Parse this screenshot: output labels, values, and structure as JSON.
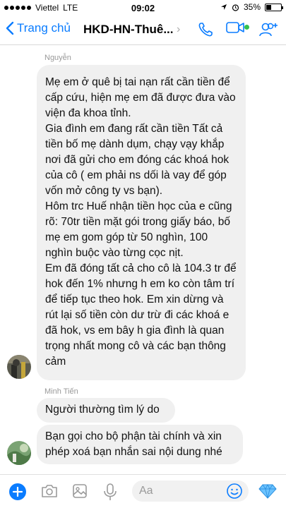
{
  "status_bar": {
    "carrier": "Viettel",
    "network": "LTE",
    "time": "09:02",
    "battery": "35%",
    "battery_level": 0.35
  },
  "nav": {
    "back_label": "Trang chủ",
    "title": "HKD-HN-Thuê...",
    "chevron": "›",
    "icons": [
      "phone-icon",
      "video-icon",
      "add-people-icon"
    ],
    "accent": "#0a7cff"
  },
  "messages": [
    {
      "sender": "Nguyễn",
      "paragraphs": [
        "Mẹ em ở quê bị tai nạn rất cần tiền để cấp cứu,  hiện mẹ em đã được đưa vào viện đa khoa tỉnh.",
        "Gia đình em đang rất cần tiền   Tất cả tiền bố mẹ dành dụm, chạy vạy khắp nơi đã  gửi cho em đóng các khoá hok của cô ( em phải ns dối là vay để góp vốn mở công ty vs bạn).",
        "Hôm trc Huế nhận tiền học của e cũng rõ:  70tr tiền mặt gói trong giấy báo, bố mẹ em gom góp từ 50 nghìn, 100 nghìn buộc vào từng cọc nịt.",
        "Em đã đóng tất cả cho cô là 104.3 tr để hok đến 1% nhưng  h em ko còn tâm trí để tiếp tục theo hok. Em xin dừng và rút lại số tiền còn dư trừ đi các khoá e đã hok, vs em bây h gia đình là quan trọng nhất mong cô và các bạn thông cảm"
      ]
    },
    {
      "sender": "Minh Tiến",
      "bubbles": [
        "Người thường tìm lý do",
        "Bạn gọi cho bộ phận tài chính và xin phép xoá bạn nhắn sai nội dung nhé"
      ]
    }
  ],
  "composer": {
    "placeholder": "Aa",
    "icons": [
      "plus-icon",
      "camera-icon",
      "image-icon",
      "microphone-icon",
      "emoji-icon",
      "diamond-icon"
    ]
  }
}
